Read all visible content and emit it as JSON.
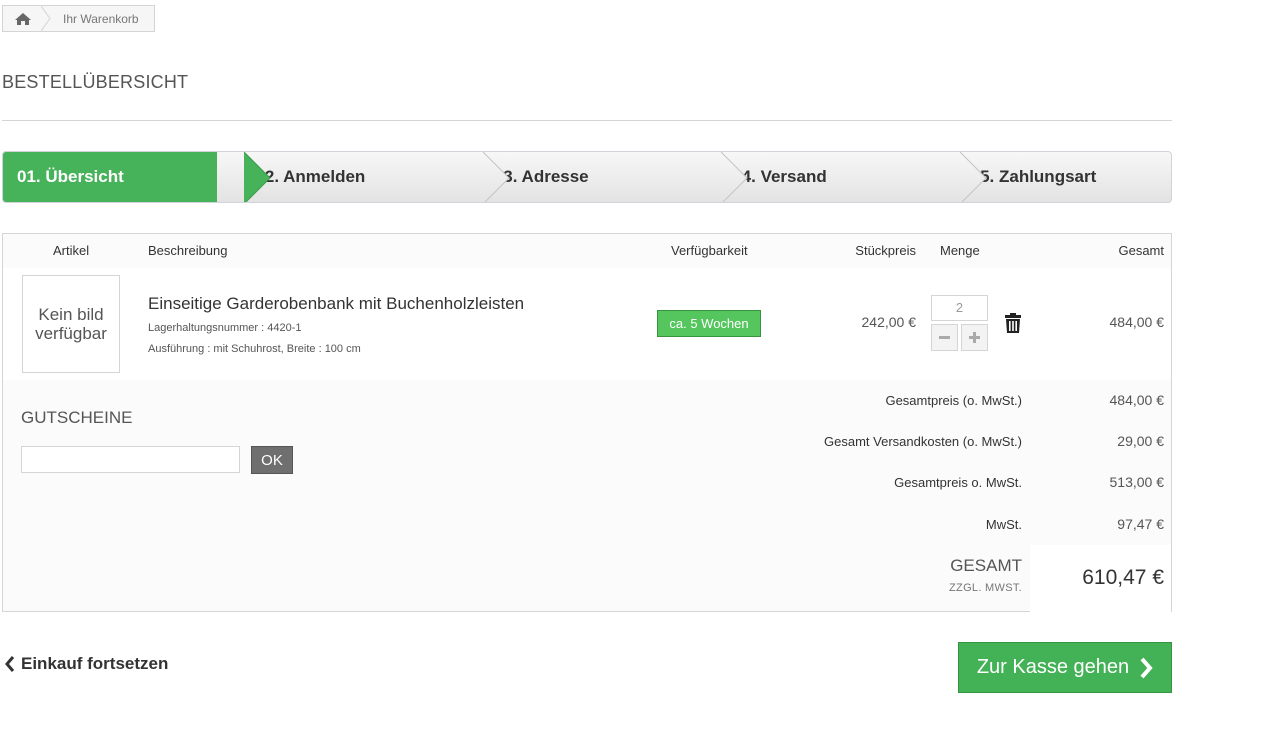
{
  "breadcrumb": {
    "home_icon": "home-icon",
    "current": "Ihr Warenkorb"
  },
  "page_title": "BESTELLÜBERSICHT",
  "steps": [
    {
      "label": "01. Übersicht",
      "active": true
    },
    {
      "label": "02. Anmelden",
      "active": false
    },
    {
      "label": "03. Adresse",
      "active": false
    },
    {
      "label": "04. Versand",
      "active": false
    },
    {
      "label": "05. Zahlungsart",
      "active": false
    }
  ],
  "table": {
    "headers": {
      "artikel": "Artikel",
      "beschreibung": "Beschreibung",
      "verfuegbarkeit": "Verfügbarkeit",
      "stueckpreis": "Stückpreis",
      "menge": "Menge",
      "gesamt": "Gesamt"
    },
    "items": [
      {
        "image_placeholder": "Kein bild verfügbar",
        "name": "Einseitige Garderobenbank mit Buchenholzleisten",
        "sku": "Lagerhaltungsnummer : 4420-1",
        "variant": "Ausführung : mit Schuhrost, Breite : 100 cm",
        "availability": "ca. 5 Wochen",
        "unit_price": "242,00 €",
        "quantity": "2",
        "total": "484,00 €"
      }
    ]
  },
  "voucher": {
    "title": "GUTSCHEINE",
    "input_value": "",
    "button": "OK"
  },
  "summary": [
    {
      "label": "Gesamtpreis (o. MwSt.)",
      "value": "484,00 €"
    },
    {
      "label": "Gesamt Versandkosten (o. MwSt.)",
      "value": "29,00 €"
    },
    {
      "label": "Gesamtpreis o. MwSt.",
      "value": "513,00 €"
    },
    {
      "label": "MwSt.",
      "value": "97,47 €"
    }
  ],
  "grand_total": {
    "label": "GESAMT",
    "sublabel": "ZZGL. MWST.",
    "value": "610,47 €"
  },
  "actions": {
    "continue": "Einkauf fortsetzen",
    "checkout": "Zur Kasse gehen"
  },
  "colors": {
    "accent_green": "#46b35a",
    "availability_green": "#55c65e",
    "ok_button": "#6f6f6f"
  }
}
